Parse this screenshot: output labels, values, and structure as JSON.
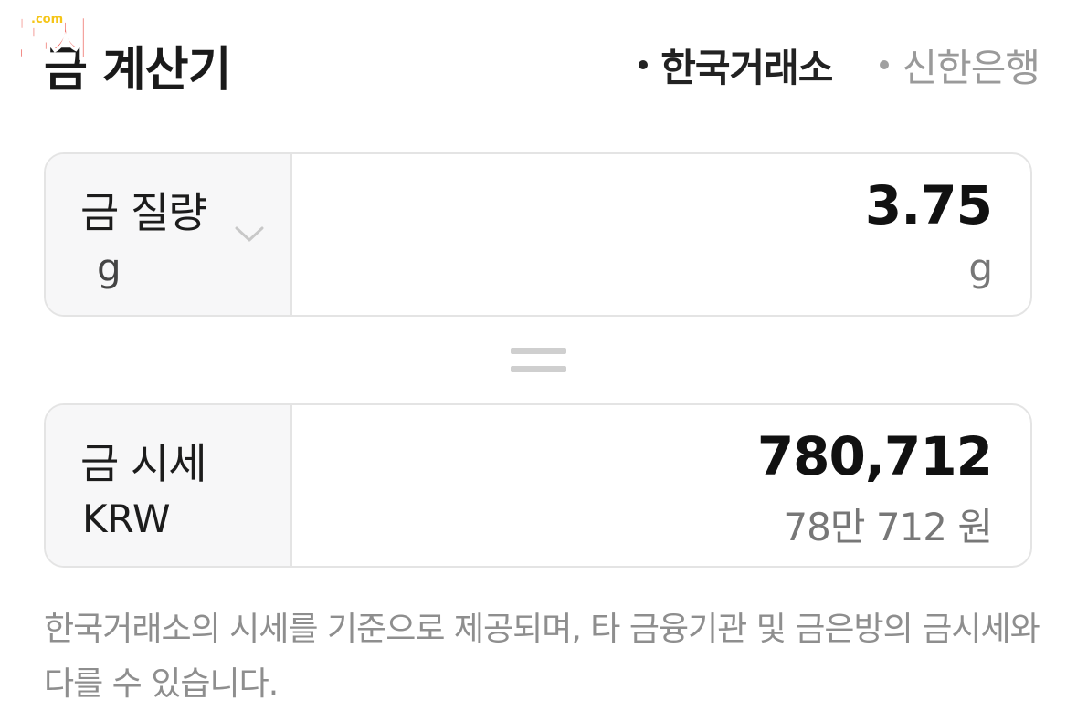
{
  "logo": {
    "text": "놀자",
    "tld": ".com"
  },
  "header": {
    "title": "금 계산기",
    "sources": [
      {
        "label": "한국거래소",
        "active": true
      },
      {
        "label": "신한은행",
        "active": false
      }
    ]
  },
  "weight": {
    "label": "금 질량",
    "unit": "g",
    "value": "3.75",
    "value_unit": "g"
  },
  "price": {
    "label": "금 시세",
    "currency": "KRW",
    "value": "780,712",
    "value_korean": "78만 712 원"
  },
  "note": "한국거래소의 시세를 기준으로 제공되며, 타 금융기관 및 금은방의 금시세와 다를 수 있습니다.",
  "colors": {
    "border": "#e4e4e4",
    "label_bg": "#f7f7f8",
    "muted_text": "#8e8e8e",
    "logo_red": "#e8332a",
    "logo_yellow": "#f5c518"
  }
}
